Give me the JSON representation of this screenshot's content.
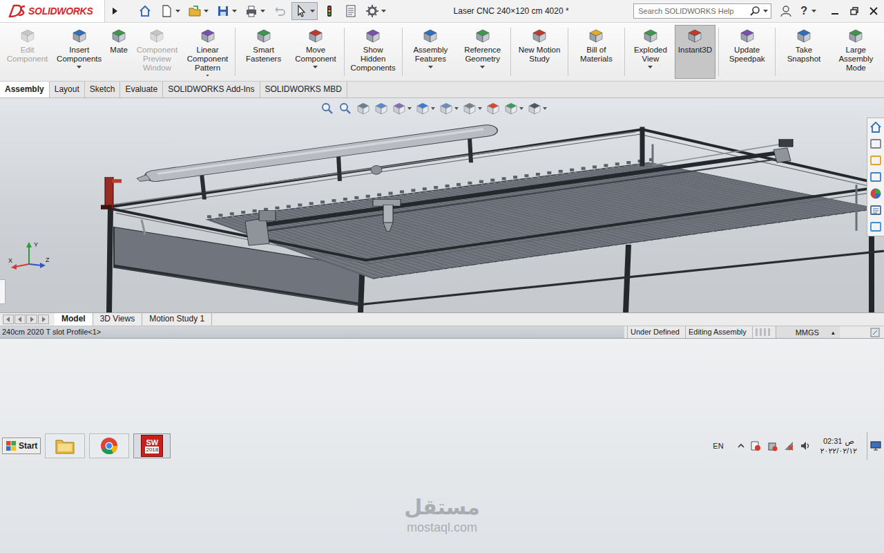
{
  "app": {
    "logo": "SOLIDWORKS"
  },
  "window": {
    "title": "Laser CNC 240×120 cm 4020 *"
  },
  "search": {
    "placeholder": "Search SOLIDWORKS Help"
  },
  "help": "?",
  "ribbon_groups": [
    [
      {
        "label": "Edit Component",
        "disabled": true,
        "selected": false,
        "dropdown": false
      },
      {
        "label": "Insert Components",
        "disabled": false,
        "selected": false,
        "dropdown": true
      },
      {
        "label": "Mate",
        "disabled": false,
        "selected": false,
        "dropdown": false
      },
      {
        "label": "Component Preview Window",
        "disabled": true,
        "selected": false,
        "dropdown": false
      },
      {
        "label": "Linear Component Pattern",
        "disabled": false,
        "selected": false,
        "dropdown": true
      }
    ],
    [
      {
        "label": "Smart Fasteners",
        "disabled": false,
        "selected": false,
        "dropdown": false
      },
      {
        "label": "Move Component",
        "disabled": false,
        "selected": false,
        "dropdown": true
      }
    ],
    [
      {
        "label": "Show Hidden Components",
        "disabled": false,
        "selected": false,
        "dropdown": false
      }
    ],
    [
      {
        "label": "Assembly Features",
        "disabled": false,
        "selected": false,
        "dropdown": true
      },
      {
        "label": "Reference Geometry",
        "disabled": false,
        "selected": false,
        "dropdown": true
      }
    ],
    [
      {
        "label": "New Motion Study",
        "disabled": false,
        "selected": false,
        "dropdown": false
      }
    ],
    [
      {
        "label": "Bill of Materials",
        "disabled": false,
        "selected": false,
        "dropdown": false
      }
    ],
    [
      {
        "label": "Exploded View",
        "disabled": false,
        "selected": false,
        "dropdown": true
      },
      {
        "label": "Instant3D",
        "disabled": false,
        "selected": true,
        "dropdown": false
      }
    ],
    [
      {
        "label": "Update Speedpak",
        "disabled": false,
        "selected": false,
        "dropdown": false
      }
    ],
    [
      {
        "label": "Take Snapshot",
        "disabled": false,
        "selected": false,
        "dropdown": false
      },
      {
        "label": "Large Assembly Mode",
        "disabled": false,
        "selected": false,
        "dropdown": false
      }
    ]
  ],
  "tabs": [
    {
      "label": "Assembly",
      "selected": true
    },
    {
      "label": "Layout",
      "selected": false
    },
    {
      "label": "Sketch",
      "selected": false
    },
    {
      "label": "Evaluate",
      "selected": false
    },
    {
      "label": "SOLIDWORKS Add-Ins",
      "selected": false
    },
    {
      "label": "SOLIDWORKS MBD",
      "selected": false
    }
  ],
  "triad": {
    "y": "Y",
    "x": "X",
    "z": "Z"
  },
  "bottom_tabs": [
    {
      "label": "Model",
      "selected": true
    },
    {
      "label": "3D Views",
      "selected": false
    },
    {
      "label": "Motion Study 1",
      "selected": false
    }
  ],
  "status_bar": {
    "selection": "240cm 2020 T slot Profile<1>",
    "fields": [
      "Under Defined",
      "Editing Assembly"
    ],
    "units": "MMGS",
    "units_arrow": "▴"
  },
  "taskbar": {
    "start": "Start",
    "sw_label": "SW",
    "sw_version": "2018",
    "language": "EN",
    "time": "02:31",
    "period": "ص",
    "date": "٢٠٢٢/٠٢/١٢"
  },
  "watermark": {
    "arabic": "مستقل",
    "latin": "mostaql.com"
  }
}
